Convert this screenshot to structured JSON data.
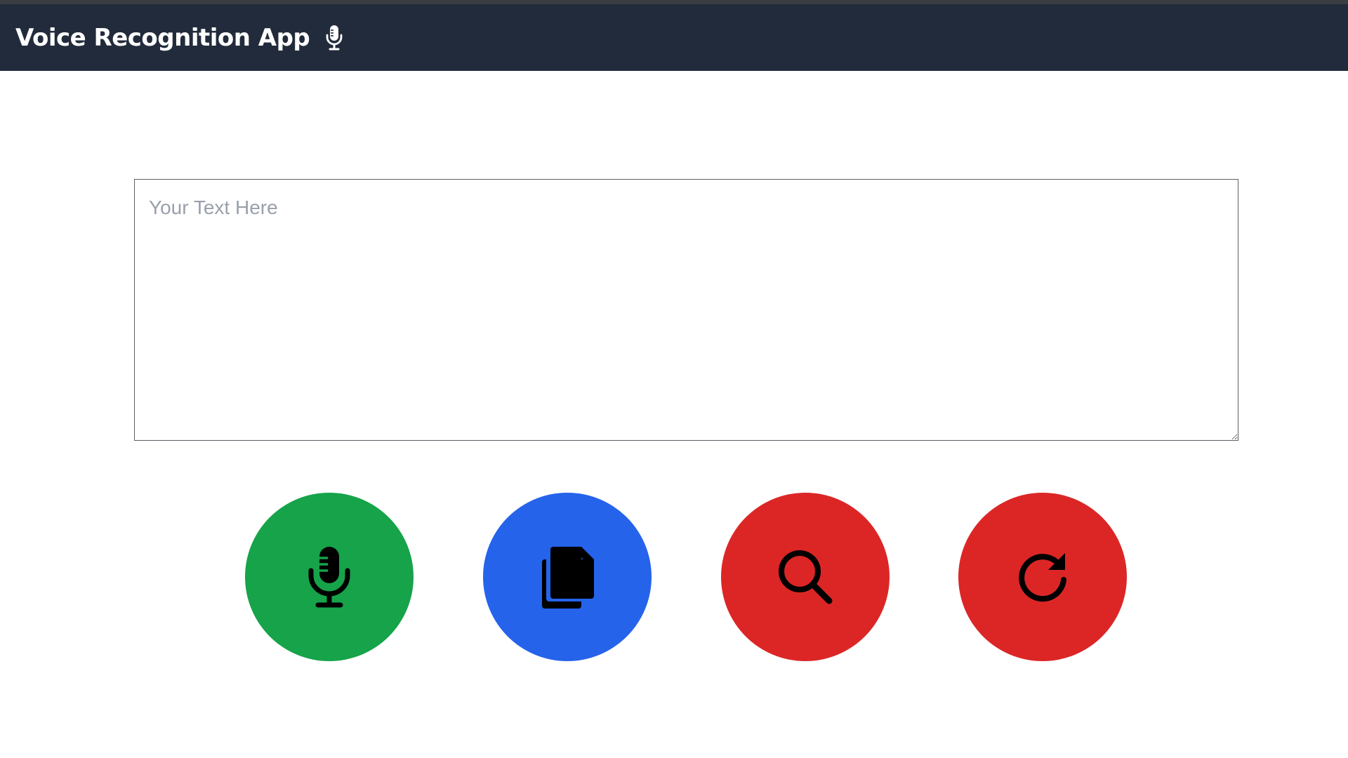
{
  "header": {
    "title": "Voice Recognition App",
    "icon": "microphone-icon"
  },
  "editor": {
    "placeholder": "Your Text Here",
    "value": ""
  },
  "actions": [
    {
      "name": "start-listening",
      "icon": "microphone-icon",
      "color": "#16a34a"
    },
    {
      "name": "copy-text",
      "icon": "copy-icon",
      "color": "#2563eb"
    },
    {
      "name": "search-text",
      "icon": "search-icon",
      "color": "#dc2626"
    },
    {
      "name": "reset-text",
      "icon": "refresh-icon",
      "color": "#dc2626"
    }
  ],
  "colors": {
    "header_bg": "#222b3b",
    "header_text": "#ffffff",
    "icon_color": "#000000"
  }
}
